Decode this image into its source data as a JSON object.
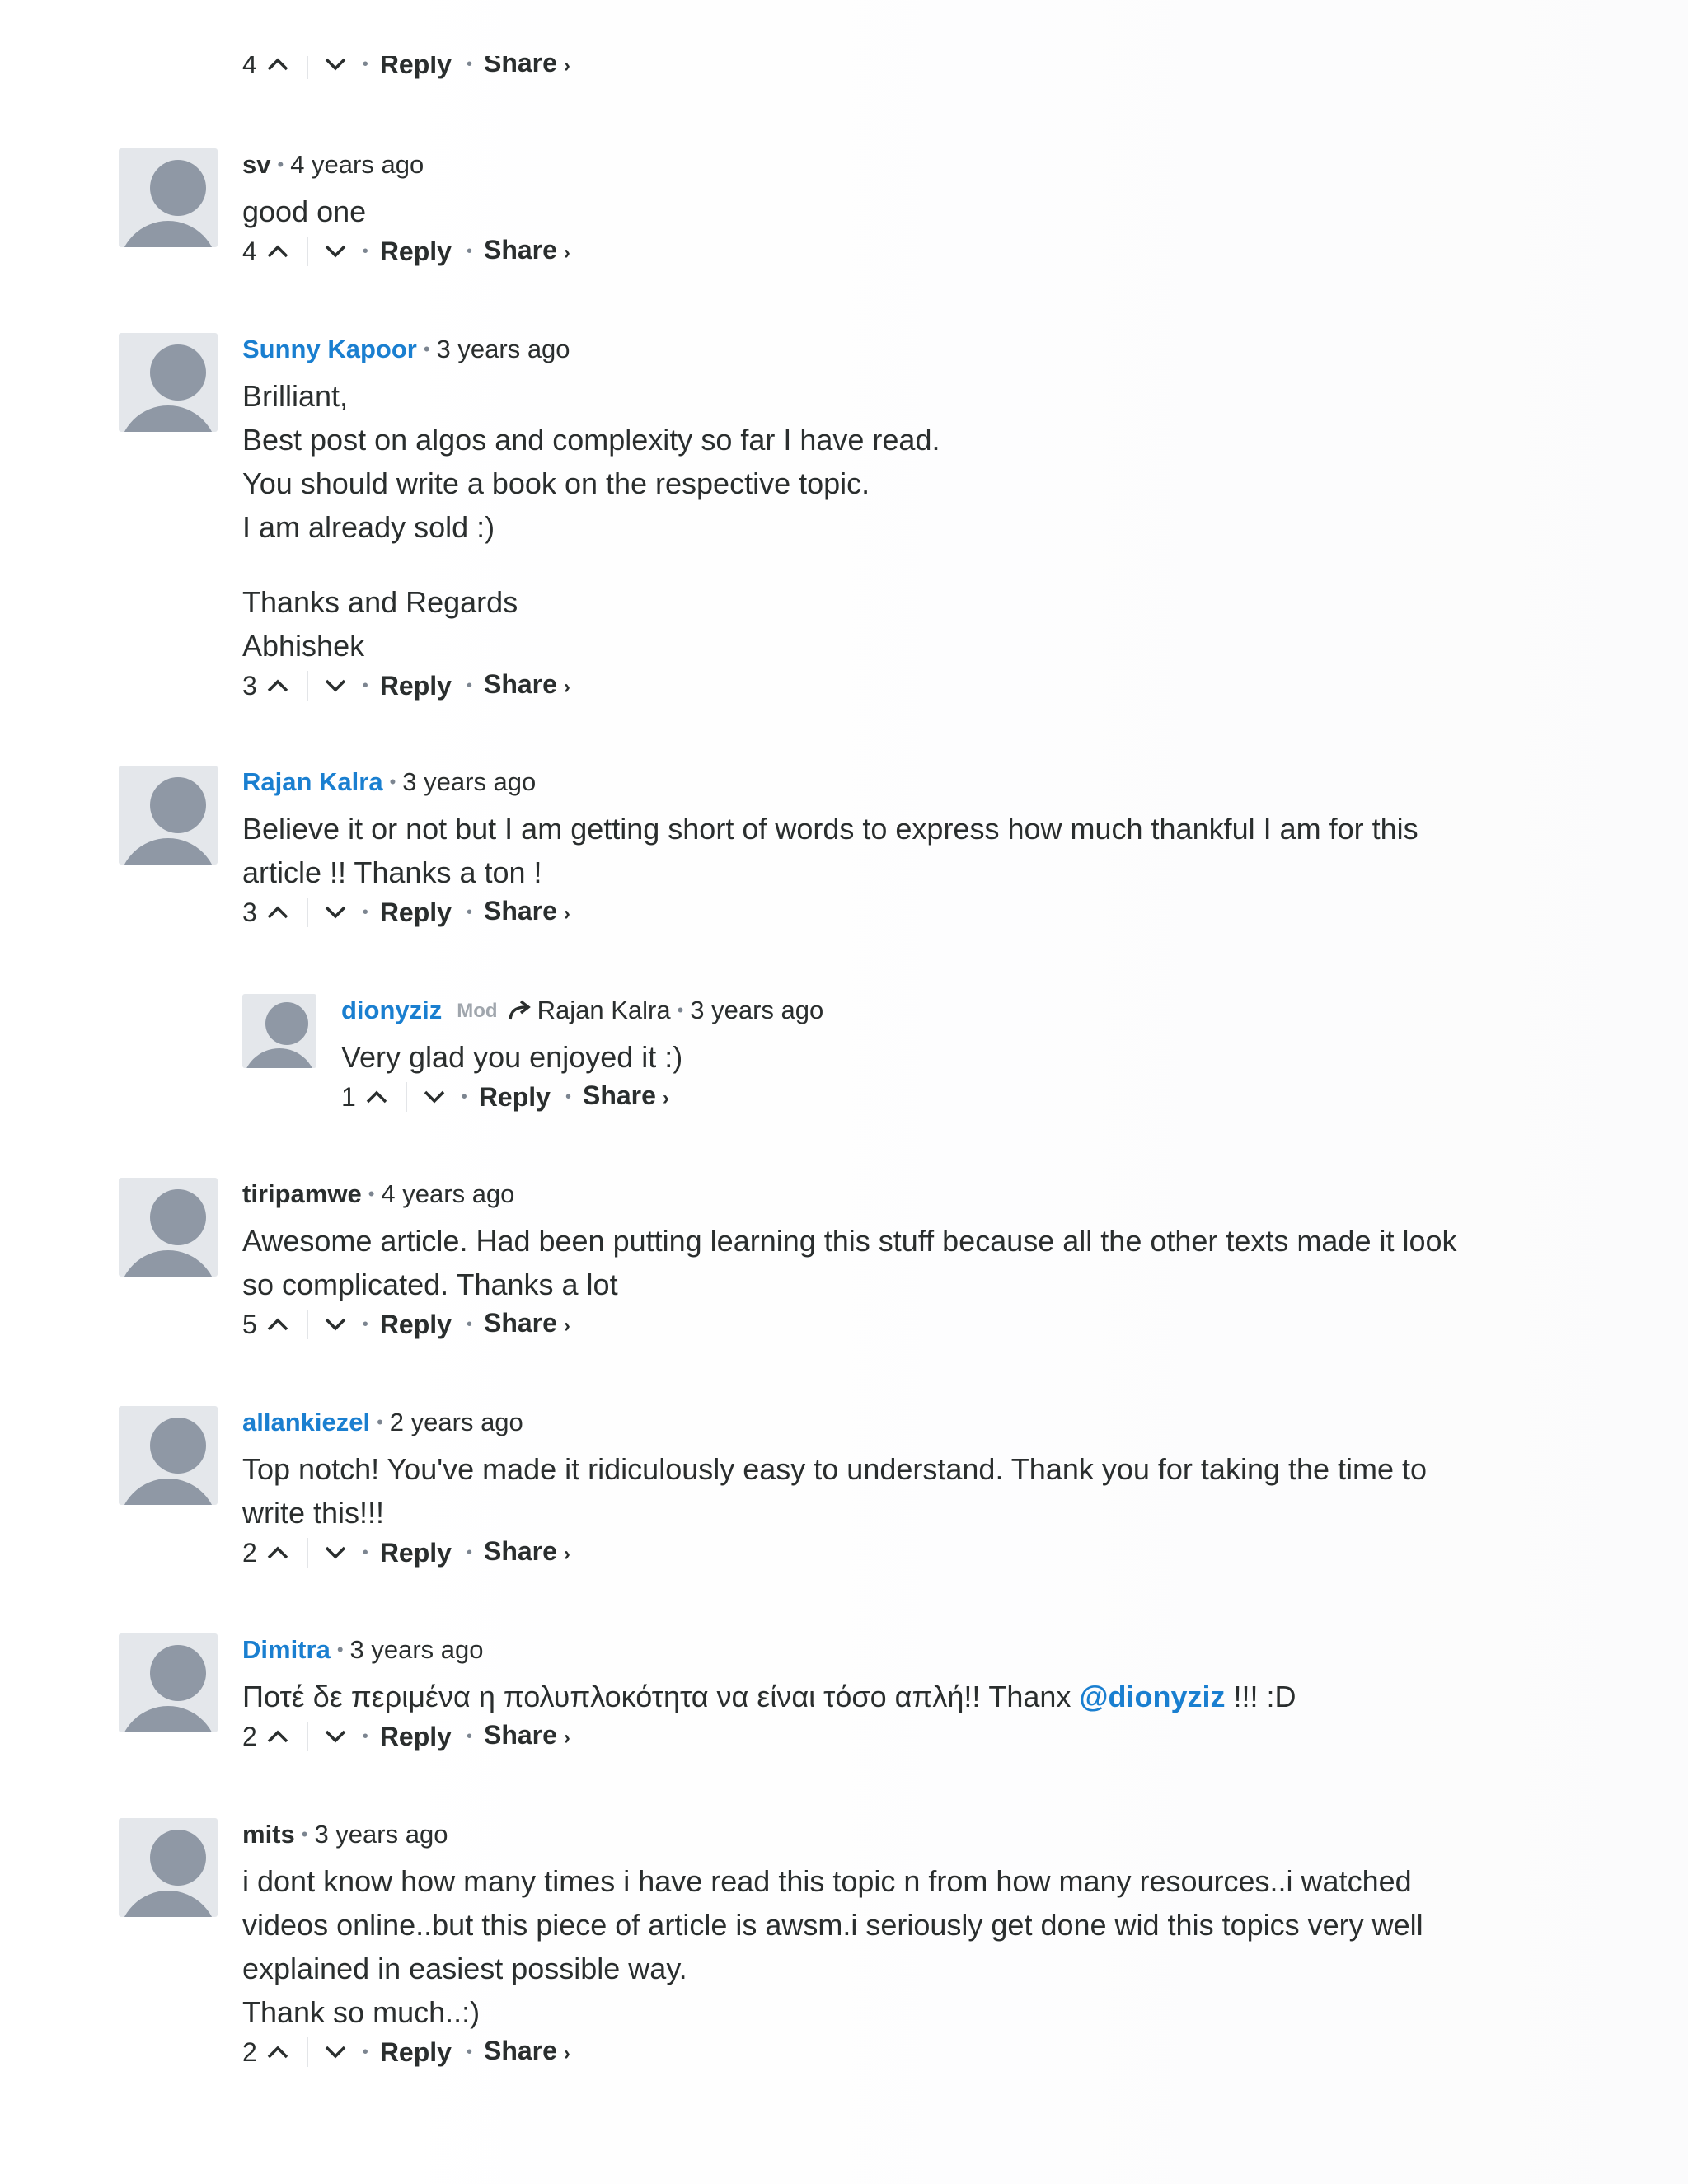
{
  "partial": {
    "votes": "4",
    "reply": "Reply",
    "share": "Share",
    "chev": "›"
  },
  "comments": [
    {
      "author": "sv",
      "time": "4 years ago",
      "votes": "4",
      "lines": [
        "good one"
      ]
    },
    {
      "author": "Sunny Kapoor",
      "time": "3 years ago",
      "votes": "3",
      "lines": [
        "Brilliant,",
        "Best post on algos and complexity so far I have read.",
        "You should write a book on the respective topic.",
        "I am already sold :)",
        "Thanks and Regards",
        "Abhishek"
      ]
    },
    {
      "author": "Rajan Kalra",
      "time": "3 years ago",
      "votes": "3",
      "lines": [
        "Believe it or not but I am getting short of words to express how much thankful I am for this",
        "article !! Thanks a ton !"
      ]
    },
    {
      "author": "dionyziz",
      "badge": "Mod",
      "reply_to": "Rajan Kalra",
      "time": "3 years ago",
      "votes": "1",
      "lines": [
        "Very glad you enjoyed it :)"
      ]
    },
    {
      "author": "tiripamwe",
      "time": "4 years ago",
      "votes": "5",
      "lines": [
        "Awesome article. Had been putting learning this stuff because all the other texts made it look",
        "so complicated. Thanks a lot"
      ]
    },
    {
      "author": "allankiezel",
      "time": "2 years ago",
      "votes": "2",
      "lines": [
        "Top notch! You've made it ridiculously easy to understand. Thank you for taking the time to",
        "write this!!!"
      ]
    },
    {
      "author": "Dimitra",
      "time": "3 years ago",
      "votes": "2",
      "text_before": "Ποτέ δε περιμένα η πολυπλοκότητα να είναι τόσο απλή!! Thanx ",
      "mention": "@dionyziz",
      "text_after": " !!! :D"
    },
    {
      "author": "mits",
      "time": "3 years ago",
      "votes": "2",
      "lines": [
        "i dont know how many times i have read this topic n from how many resources..i watched",
        "videos online..but this piece of article is awsm.i seriously get done wid this topics very well",
        "explained in easiest possible way.",
        "Thank so much..:)"
      ]
    }
  ],
  "labels": {
    "reply": "Reply",
    "share": "Share",
    "chev": "›",
    "bullet": "•"
  },
  "colors": {
    "link": "#1a7fd0",
    "text": "#2a2e2e",
    "avatar_bg": "#e4e7eb",
    "avatar_fg": "#8f98a5"
  }
}
